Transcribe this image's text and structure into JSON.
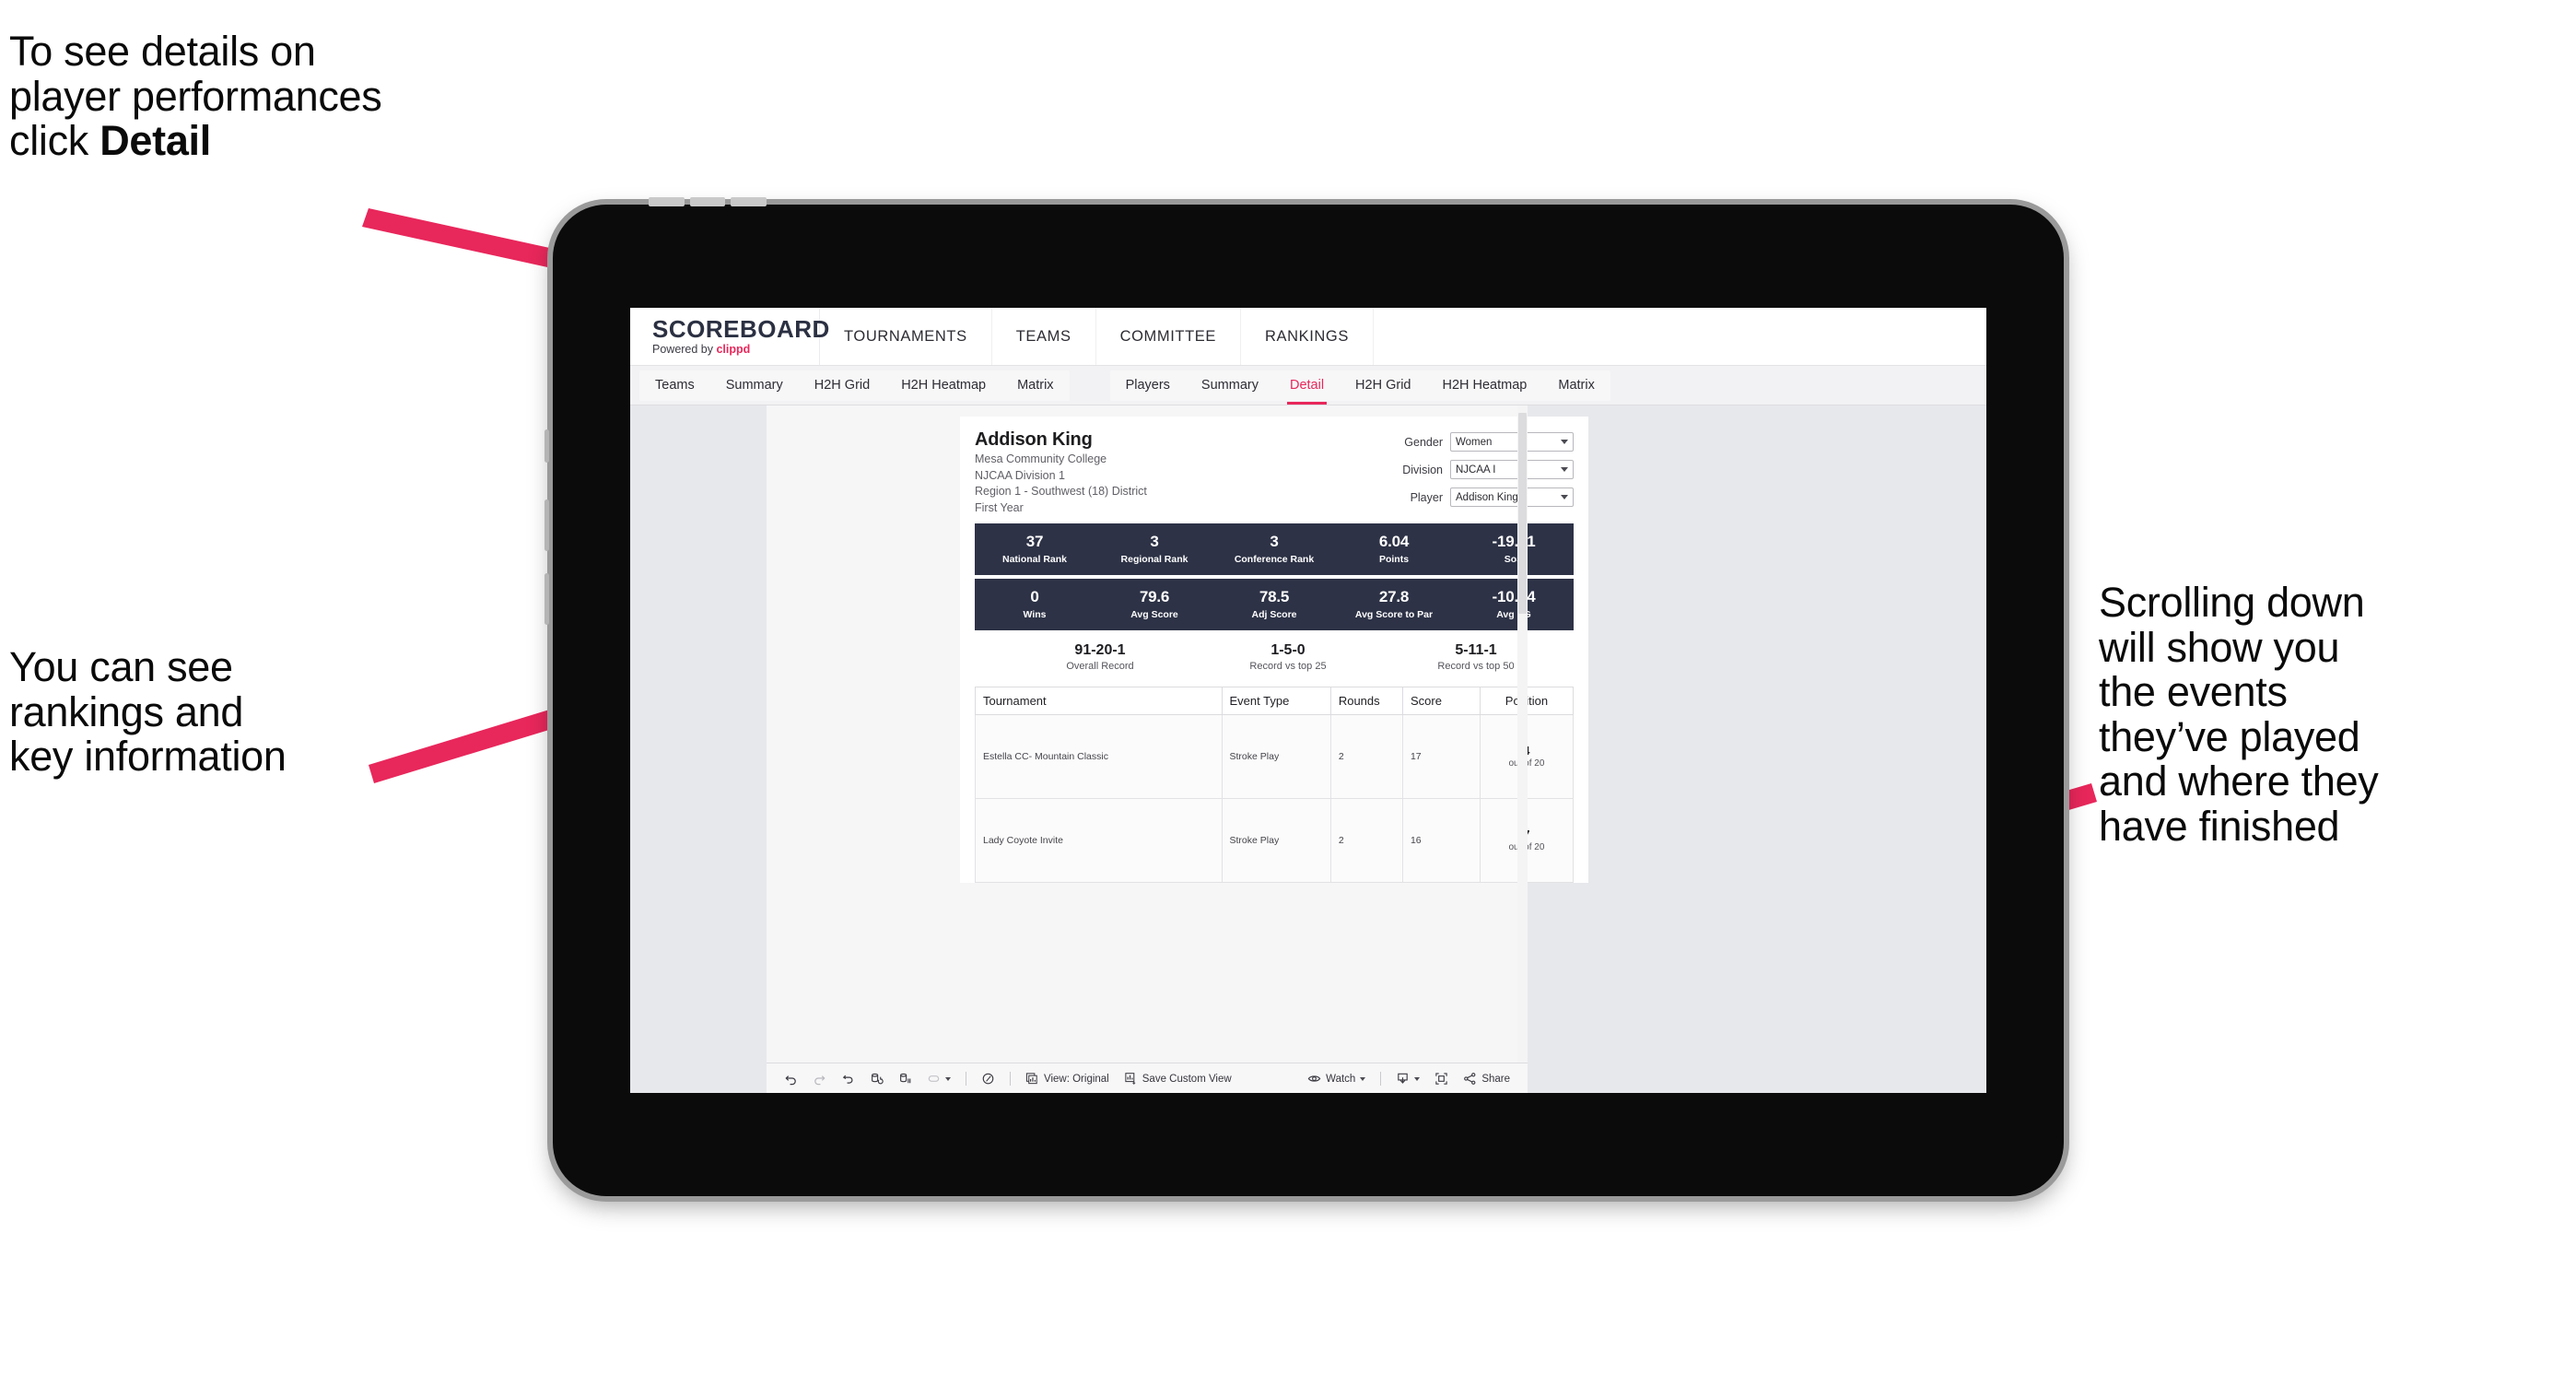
{
  "annotations": {
    "top_left": "To see details on\nplayer performances\nclick ",
    "top_left_bold": "Detail",
    "left": "You can see\nrankings and\nkey information",
    "right": "Scrolling down\nwill show you\nthe events\nthey’ve played\nand where they\nhave finished"
  },
  "colors": {
    "accent_pink": "#e8275b",
    "navy": "#2d3246",
    "screen_bg": "#e7e8ec"
  },
  "app": {
    "brand": {
      "logo": "SCOREBOARD",
      "powered_prefix": "Powered by ",
      "powered_name": "clippd"
    },
    "top_nav": [
      "TOURNAMENTS",
      "TEAMS",
      "COMMITTEE",
      "RANKINGS"
    ],
    "sub_nav_left": [
      "Teams",
      "Summary",
      "H2H Grid",
      "H2H Heatmap",
      "Matrix"
    ],
    "sub_nav_right": [
      "Players",
      "Summary",
      "Detail",
      "H2H Grid",
      "H2H Heatmap",
      "Matrix"
    ],
    "sub_nav_active": "Detail"
  },
  "player": {
    "name": "Addison King",
    "school": "Mesa Community College",
    "division": "NJCAA Division 1",
    "region": "Region 1 - Southwest (18) District",
    "year": "First Year"
  },
  "filters": [
    {
      "label": "Gender",
      "value": "Women"
    },
    {
      "label": "Division",
      "value": "NJCAA I"
    },
    {
      "label": "Player",
      "value": "Addison King"
    }
  ],
  "stats_primary": [
    {
      "value": "37",
      "label": "National Rank"
    },
    {
      "value": "3",
      "label": "Regional Rank"
    },
    {
      "value": "3",
      "label": "Conference Rank"
    },
    {
      "value": "6.04",
      "label": "Points"
    },
    {
      "value": "-19.71",
      "label": "SoS"
    }
  ],
  "stats_secondary": [
    {
      "value": "0",
      "label": "Wins"
    },
    {
      "value": "79.6",
      "label": "Avg Score"
    },
    {
      "value": "78.5",
      "label": "Adj Score"
    },
    {
      "value": "27.8",
      "label": "Avg Score to Par"
    },
    {
      "value": "-10.14",
      "label": "Avg SG"
    }
  ],
  "records": [
    {
      "value": "91-20-1",
      "label": "Overall Record"
    },
    {
      "value": "1-5-0",
      "label": "Record vs top 25"
    },
    {
      "value": "5-11-1",
      "label": "Record vs top 50"
    }
  ],
  "events_table": {
    "columns": [
      "Tournament",
      "Event Type",
      "Rounds",
      "Score",
      "Position"
    ],
    "rows": [
      {
        "tournament": "Estella CC- Mountain Classic",
        "event_type": "Stroke Play",
        "rounds": "2",
        "score": "17",
        "position": "4",
        "position_of": "out of 20"
      },
      {
        "tournament": "Lady Coyote Invite",
        "event_type": "Stroke Play",
        "rounds": "2",
        "score": "16",
        "position": "7",
        "position_of": "out of 20"
      }
    ]
  },
  "toolbar": {
    "view_label": "View: Original",
    "save_label": "Save Custom View",
    "watch_label": "Watch",
    "share_label": "Share"
  }
}
